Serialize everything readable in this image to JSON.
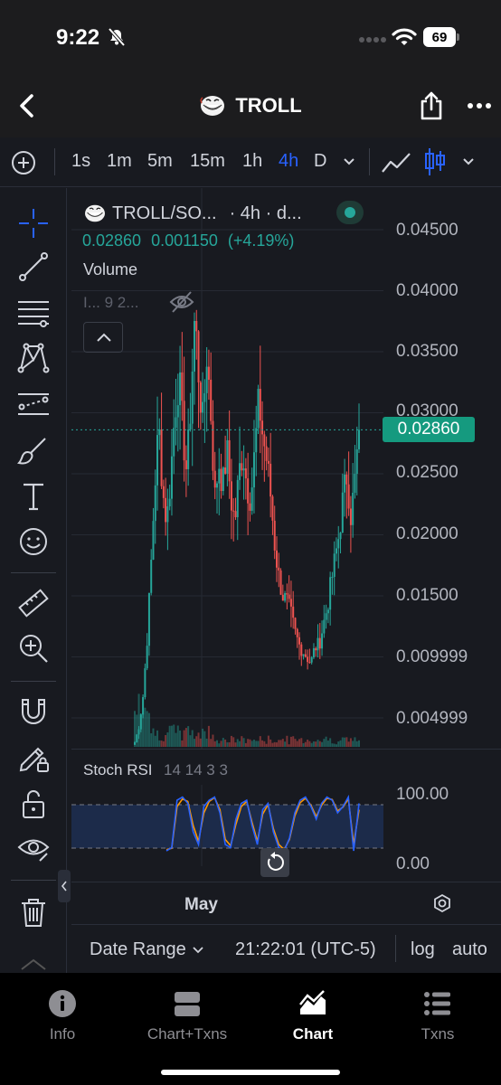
{
  "status_bar": {
    "time": "9:22",
    "battery": "69"
  },
  "header": {
    "title": "TROLL"
  },
  "timeframes": {
    "items": [
      "1s",
      "1m",
      "5m",
      "15m",
      "1h",
      "4h",
      "D"
    ],
    "active": "4h"
  },
  "legend": {
    "pair": "TROLL/SO...",
    "meta": "· 4h · d...",
    "last": "0.02860",
    "change": "0.001150",
    "change_pct": "(+4.19%)"
  },
  "volume": {
    "label": "Volume",
    "values": "I... 9 2..."
  },
  "price_axis": {
    "labels": [
      "0.04500",
      "0.04000",
      "0.03500",
      "0.03000",
      "0.02500",
      "0.02000",
      "0.01500",
      "0.009999",
      "0.004999"
    ],
    "last_price": "0.02860"
  },
  "stoch_rsi": {
    "label": "Stoch RSI",
    "params": "14 14 3 3",
    "axis": [
      "100.00",
      "0.00"
    ]
  },
  "time_axis": {
    "label": "May"
  },
  "bottom_bar": {
    "date_range": "Date Range",
    "clock": "21:22:01 (UTC-5)",
    "log": "log",
    "auto": "auto"
  },
  "tabs": [
    {
      "label": "Info",
      "icon": "info-icon"
    },
    {
      "label": "Chart+Txns",
      "icon": "split-view-icon"
    },
    {
      "label": "Chart",
      "icon": "chart-icon"
    },
    {
      "label": "Txns",
      "icon": "list-icon"
    }
  ],
  "active_tab": "Chart",
  "colors": {
    "up": "#26a69a",
    "down": "#ef5350",
    "accent": "#2962ff",
    "k_line": "#2962ff",
    "d_line": "#ff9800"
  },
  "chart_data": {
    "type": "candlestick",
    "interval": "4h",
    "ylim": [
      0.002,
      0.046
    ],
    "last": 0.0286,
    "close_series": [
      0.003,
      0.0042,
      0.0065,
      0.011,
      0.017,
      0.024,
      0.029,
      0.0235,
      0.021,
      0.025,
      0.03,
      0.033,
      0.0285,
      0.025,
      0.031,
      0.038,
      0.033,
      0.029,
      0.035,
      0.03,
      0.023,
      0.026,
      0.024,
      0.027,
      0.023,
      0.021,
      0.025,
      0.027,
      0.024,
      0.023,
      0.027,
      0.031,
      0.028,
      0.026,
      0.023,
      0.019,
      0.0165,
      0.015,
      0.0145,
      0.0135,
      0.012,
      0.011,
      0.0105,
      0.01,
      0.0095,
      0.0108,
      0.011,
      0.0125,
      0.014,
      0.016,
      0.018,
      0.02,
      0.023,
      0.025,
      0.0215,
      0.0245,
      0.0286
    ],
    "stoch_k": [
      10,
      15,
      90,
      95,
      85,
      40,
      20,
      80,
      90,
      95,
      70,
      20,
      15,
      60,
      85,
      90,
      50,
      20,
      75,
      85,
      40,
      15,
      10,
      30,
      70,
      90,
      95,
      80,
      60,
      85,
      95,
      90,
      70,
      80,
      95,
      10,
      85
    ],
    "stoch_d": [
      12,
      14,
      80,
      92,
      88,
      50,
      25,
      70,
      88,
      94,
      75,
      28,
      18,
      52,
      80,
      88,
      55,
      25,
      68,
      83,
      45,
      20,
      12,
      28,
      65,
      86,
      93,
      82,
      64,
      82,
      93,
      91,
      73,
      79,
      92,
      20,
      75
    ],
    "stoch_levels": [
      80,
      20
    ]
  }
}
